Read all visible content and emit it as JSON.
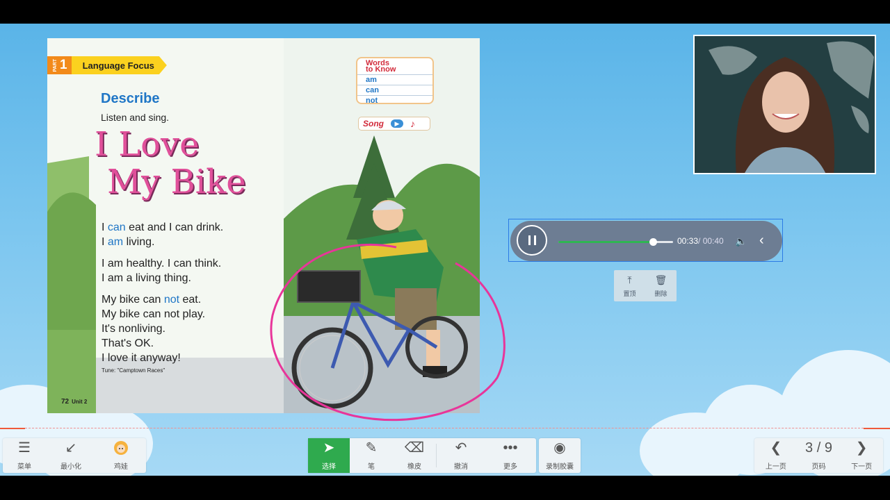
{
  "book_page": {
    "part_label": "PART",
    "part_number": "1",
    "section": "Language Focus",
    "words_to_know": {
      "title_line1": "Words",
      "title_line2": "to Know",
      "items": [
        "am",
        "can",
        "not"
      ]
    },
    "song_label": "Song",
    "heading": "Describe",
    "instruction": "Listen and sing.",
    "title_line1": "I Love",
    "title_line2": "My Bike",
    "lyrics": [
      {
        "pre": "I ",
        "hl": "can",
        "post": " eat and I can drink."
      },
      {
        "pre": "I ",
        "hl": "am",
        "post": " living."
      },
      {
        "pre": "I am healthy. I can think.",
        "hl": "",
        "post": ""
      },
      {
        "pre": "I am a living thing.",
        "hl": "",
        "post": ""
      },
      {
        "pre": "My bike can ",
        "hl": "not",
        "post": " eat."
      },
      {
        "pre": "My bike can not play.",
        "hl": "",
        "post": ""
      },
      {
        "pre": "It's nonliving.",
        "hl": "",
        "post": ""
      },
      {
        "pre": "That's OK.",
        "hl": "",
        "post": ""
      },
      {
        "pre": "I love it anyway!",
        "hl": "",
        "post": ""
      }
    ],
    "tune": "Tune: \"Camptown Races\"",
    "page_number": "72",
    "unit": "Unit 2"
  },
  "audio_player": {
    "current_time": "00:33",
    "duration": "/ 00:40",
    "progress": 0.825
  },
  "context_menu": {
    "pin_label": "置顶",
    "delete_label": "删除"
  },
  "toolbar": {
    "menu_label": "菜单",
    "minimize_label": "最小化",
    "avatar_label": "鸡娃",
    "select_label": "选择",
    "pen_label": "笔",
    "eraser_label": "橡皮",
    "undo_label": "撤消",
    "more_label": "更多",
    "record_label": "录制胶囊",
    "prev_label": "上一页",
    "page_indicator": "3 / 9",
    "page_label": "页码",
    "next_label": "下一页"
  },
  "colors": {
    "active_tool": "#2faa4e",
    "annotation": "#e8359a",
    "progress": "#2fb552"
  }
}
